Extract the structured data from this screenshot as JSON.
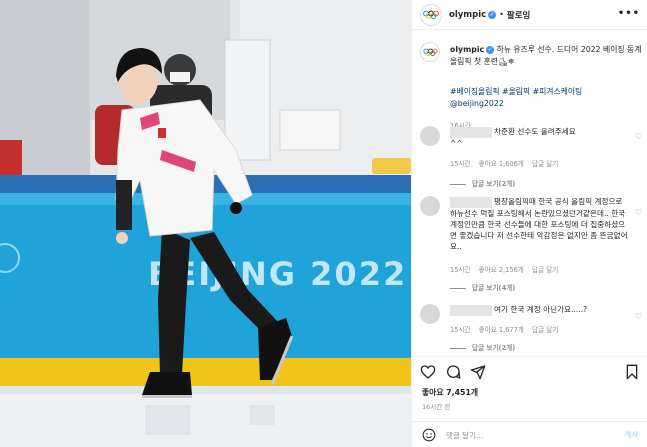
{
  "header": {
    "username": "olympic",
    "separator": "•",
    "follow_label": "팔로잉",
    "more_icon": "more-horizontal-icon"
  },
  "caption": {
    "username": "olympic",
    "text": "하뉴 유즈루 선수. 드디어 2022 베이징 동계올림픽 첫 훈련⛸❄",
    "hashtags": "#베이징올림픽 #올림픽 #피겨스케이팅",
    "mention": "@beijing2022",
    "time": "16시간"
  },
  "comments": [
    {
      "text": "차준환 선수도 올려주세요",
      "text2": "^^",
      "time": "15시간",
      "likes": "좋아요 1,606개",
      "reply": "답글 달기",
      "view_replies": "답글 보기(2개)"
    },
    {
      "text": "평창올림픽때 한국 공식 올림픽 계정으로 하뉴선수 먹질 포스팅해서 논란있으셨던거같은데.. 한국 계정인만큼 한국 선수들에 대한 포스팅에 더 집중하셨으면 좋겠습니다 저 선수한테 악감정은 없지만 좀 뜬금없어요..",
      "time": "15시간",
      "likes": "좋아요 2,156개",
      "reply": "답글 달기",
      "view_replies": "답글 보기(4개)"
    },
    {
      "text": "여기 한국 계정 아닌가요.....?",
      "time": "15시간",
      "likes": "좋아요 1,677개",
      "reply": "답글 달기",
      "view_replies": "답글 보기(2개)"
    }
  ],
  "actions": {
    "icons": [
      "heart-icon",
      "comment-icon",
      "share-icon",
      "bookmark-icon"
    ]
  },
  "likes_total": "좋아요 7,451개",
  "post_time": "16시간 전",
  "comment_input": {
    "placeholder": "댓글 달기...",
    "post_label": "게시"
  },
  "photo": {
    "banner_text": "BEIJING 2022"
  },
  "colors": {
    "link": "#00376b",
    "verified": "#3897f0",
    "muted": "#8e8e8e",
    "post_button": "#b2dffc",
    "rink_board": "#1fa3d9"
  }
}
